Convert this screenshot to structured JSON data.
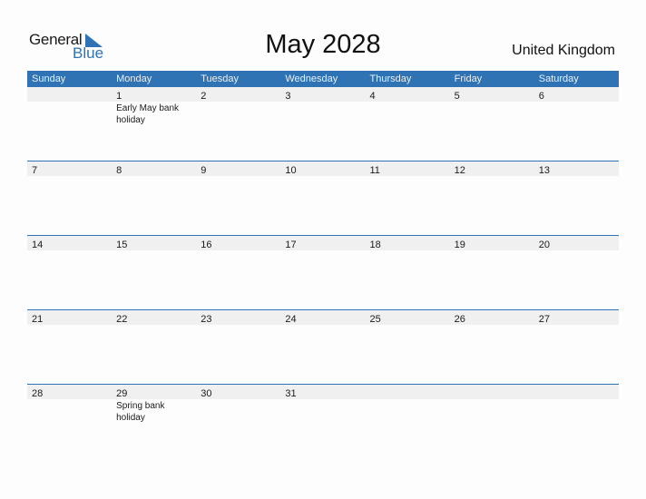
{
  "logo": {
    "line1": "General",
    "line2": "Blue"
  },
  "title": "May 2028",
  "country": "United Kingdom",
  "colors": {
    "accent": "#2f73b4",
    "strip": "#f0f0f0"
  },
  "weekdays": [
    "Sunday",
    "Monday",
    "Tuesday",
    "Wednesday",
    "Thursday",
    "Friday",
    "Saturday"
  ],
  "weeks": [
    [
      {
        "d": ""
      },
      {
        "d": "1",
        "ev": "Early May bank holiday"
      },
      {
        "d": "2"
      },
      {
        "d": "3"
      },
      {
        "d": "4"
      },
      {
        "d": "5"
      },
      {
        "d": "6"
      }
    ],
    [
      {
        "d": "7"
      },
      {
        "d": "8"
      },
      {
        "d": "9"
      },
      {
        "d": "10"
      },
      {
        "d": "11"
      },
      {
        "d": "12"
      },
      {
        "d": "13"
      }
    ],
    [
      {
        "d": "14"
      },
      {
        "d": "15"
      },
      {
        "d": "16"
      },
      {
        "d": "17"
      },
      {
        "d": "18"
      },
      {
        "d": "19"
      },
      {
        "d": "20"
      }
    ],
    [
      {
        "d": "21"
      },
      {
        "d": "22"
      },
      {
        "d": "23"
      },
      {
        "d": "24"
      },
      {
        "d": "25"
      },
      {
        "d": "26"
      },
      {
        "d": "27"
      }
    ],
    [
      {
        "d": "28"
      },
      {
        "d": "29",
        "ev": "Spring bank holiday"
      },
      {
        "d": "30"
      },
      {
        "d": "31"
      },
      {
        "d": ""
      },
      {
        "d": ""
      },
      {
        "d": ""
      }
    ]
  ]
}
